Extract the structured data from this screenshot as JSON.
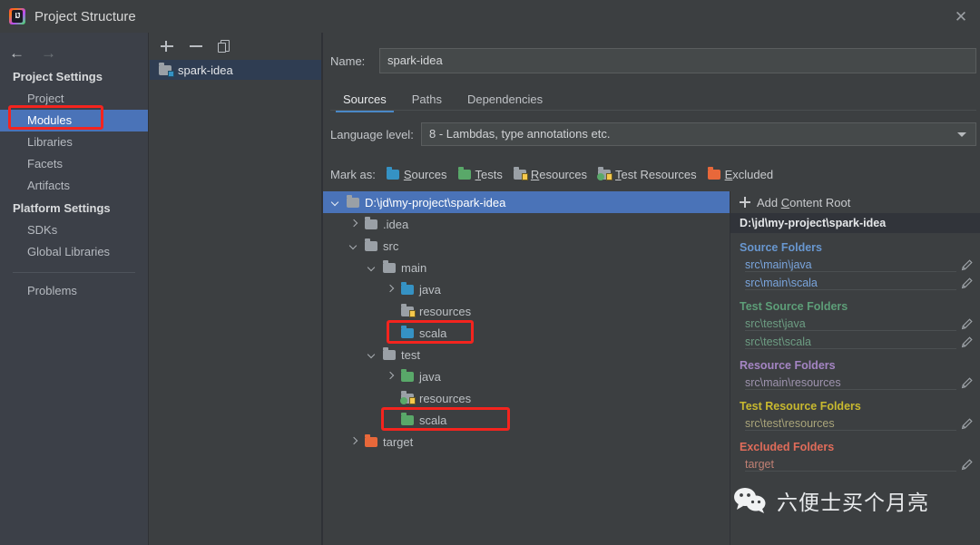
{
  "window": {
    "title": "Project Structure",
    "app_icon": "intellij-idea-icon",
    "close_label": "✕"
  },
  "sidebar": {
    "back_arrow": "←",
    "forward_arrow": "→",
    "groups": [
      {
        "title": "Project Settings",
        "items": [
          {
            "label": "Project",
            "selected": false
          },
          {
            "label": "Modules",
            "selected": true,
            "highlighted": true
          },
          {
            "label": "Libraries",
            "selected": false
          },
          {
            "label": "Facets",
            "selected": false
          },
          {
            "label": "Artifacts",
            "selected": false
          }
        ]
      },
      {
        "title": "Platform Settings",
        "items": [
          {
            "label": "SDKs",
            "selected": false
          },
          {
            "label": "Global Libraries",
            "selected": false
          }
        ]
      }
    ],
    "footer_items": [
      {
        "label": "Problems",
        "selected": false
      }
    ]
  },
  "modules_panel": {
    "toolbar": {
      "add": "add-icon",
      "remove": "remove-icon",
      "copy": "copy-icon"
    },
    "modules": [
      {
        "label": "spark-idea",
        "selected": true
      }
    ]
  },
  "main": {
    "name_label": "Name:",
    "name_value": "spark-idea",
    "tabs": [
      {
        "label": "Sources",
        "active": true
      },
      {
        "label": "Paths",
        "active": false
      },
      {
        "label": "Dependencies",
        "active": false
      }
    ],
    "language_level_label": "Language level:",
    "language_level_value": "8 - Lambdas, type annotations etc.",
    "mark_as_label": "Mark as:",
    "mark_as_options": [
      {
        "label": "Sources",
        "color": "#3592c4",
        "kind": "plain"
      },
      {
        "label": "Tests",
        "color": "#59a869",
        "kind": "plain"
      },
      {
        "label": "Resources",
        "color": "#9aa0a6",
        "kind": "resource"
      },
      {
        "label": "Test Resources",
        "color": "#9aa0a6",
        "kind": "test-resource"
      },
      {
        "label": "Excluded",
        "color": "#e8683a",
        "kind": "plain"
      }
    ]
  },
  "tree": {
    "nodes": [
      {
        "label": "D:\\jd\\my-project\\spark-idea",
        "depth": 0,
        "twisty": "down",
        "folder": "grey",
        "selected": true
      },
      {
        "label": ".idea",
        "depth": 1,
        "twisty": "right",
        "folder": "grey",
        "selected": false
      },
      {
        "label": "src",
        "depth": 1,
        "twisty": "down",
        "folder": "grey",
        "selected": false
      },
      {
        "label": "main",
        "depth": 2,
        "twisty": "down",
        "folder": "grey",
        "selected": false
      },
      {
        "label": "java",
        "depth": 3,
        "twisty": "right",
        "folder": "blue",
        "selected": false
      },
      {
        "label": "resources",
        "depth": 3,
        "twisty": "none",
        "folder": "resource",
        "selected": false
      },
      {
        "label": "scala",
        "depth": 3,
        "twisty": "none",
        "folder": "blue",
        "selected": false,
        "highlighted": true
      },
      {
        "label": "test",
        "depth": 2,
        "twisty": "down",
        "folder": "grey",
        "selected": false
      },
      {
        "label": "java",
        "depth": 3,
        "twisty": "right",
        "folder": "green",
        "selected": false
      },
      {
        "label": "resources",
        "depth": 3,
        "twisty": "none",
        "folder": "test-resource",
        "selected": false
      },
      {
        "label": "scala",
        "depth": 3,
        "twisty": "none",
        "folder": "green",
        "selected": false,
        "highlighted": true
      },
      {
        "label": "target",
        "depth": 1,
        "twisty": "right",
        "folder": "orange",
        "selected": false
      }
    ]
  },
  "right_panel": {
    "add_content_root": "Add Content Root",
    "root_path": "D:\\jd\\my-project\\spark-idea",
    "groups": [
      {
        "title": "Source Folders",
        "color": "#6897d0",
        "paths": [
          "src\\main\\java",
          "src\\main\\scala"
        ]
      },
      {
        "title": "Test Source Folders",
        "color": "#5d9e78",
        "paths": [
          "src\\test\\java",
          "src\\test\\scala"
        ]
      },
      {
        "title": "Resource Folders",
        "color": "#a585c4",
        "paths": [
          "src\\main\\resources"
        ]
      },
      {
        "title": "Test Resource Folders",
        "color": "#c8b92f",
        "paths": [
          "src\\test\\resources"
        ]
      },
      {
        "title": "Excluded Folders",
        "color": "#e06c5a",
        "paths": [
          "target"
        ]
      }
    ]
  },
  "watermark": {
    "icon": "wechat-icon",
    "text": "六便士买个月亮"
  },
  "theme": {
    "background": "#3c3f41",
    "sidebar_background": "#3c4048",
    "selection_blue": "#4a73b8",
    "accent_blue": "#4a88c7",
    "annotation_red": "#f4241e"
  }
}
